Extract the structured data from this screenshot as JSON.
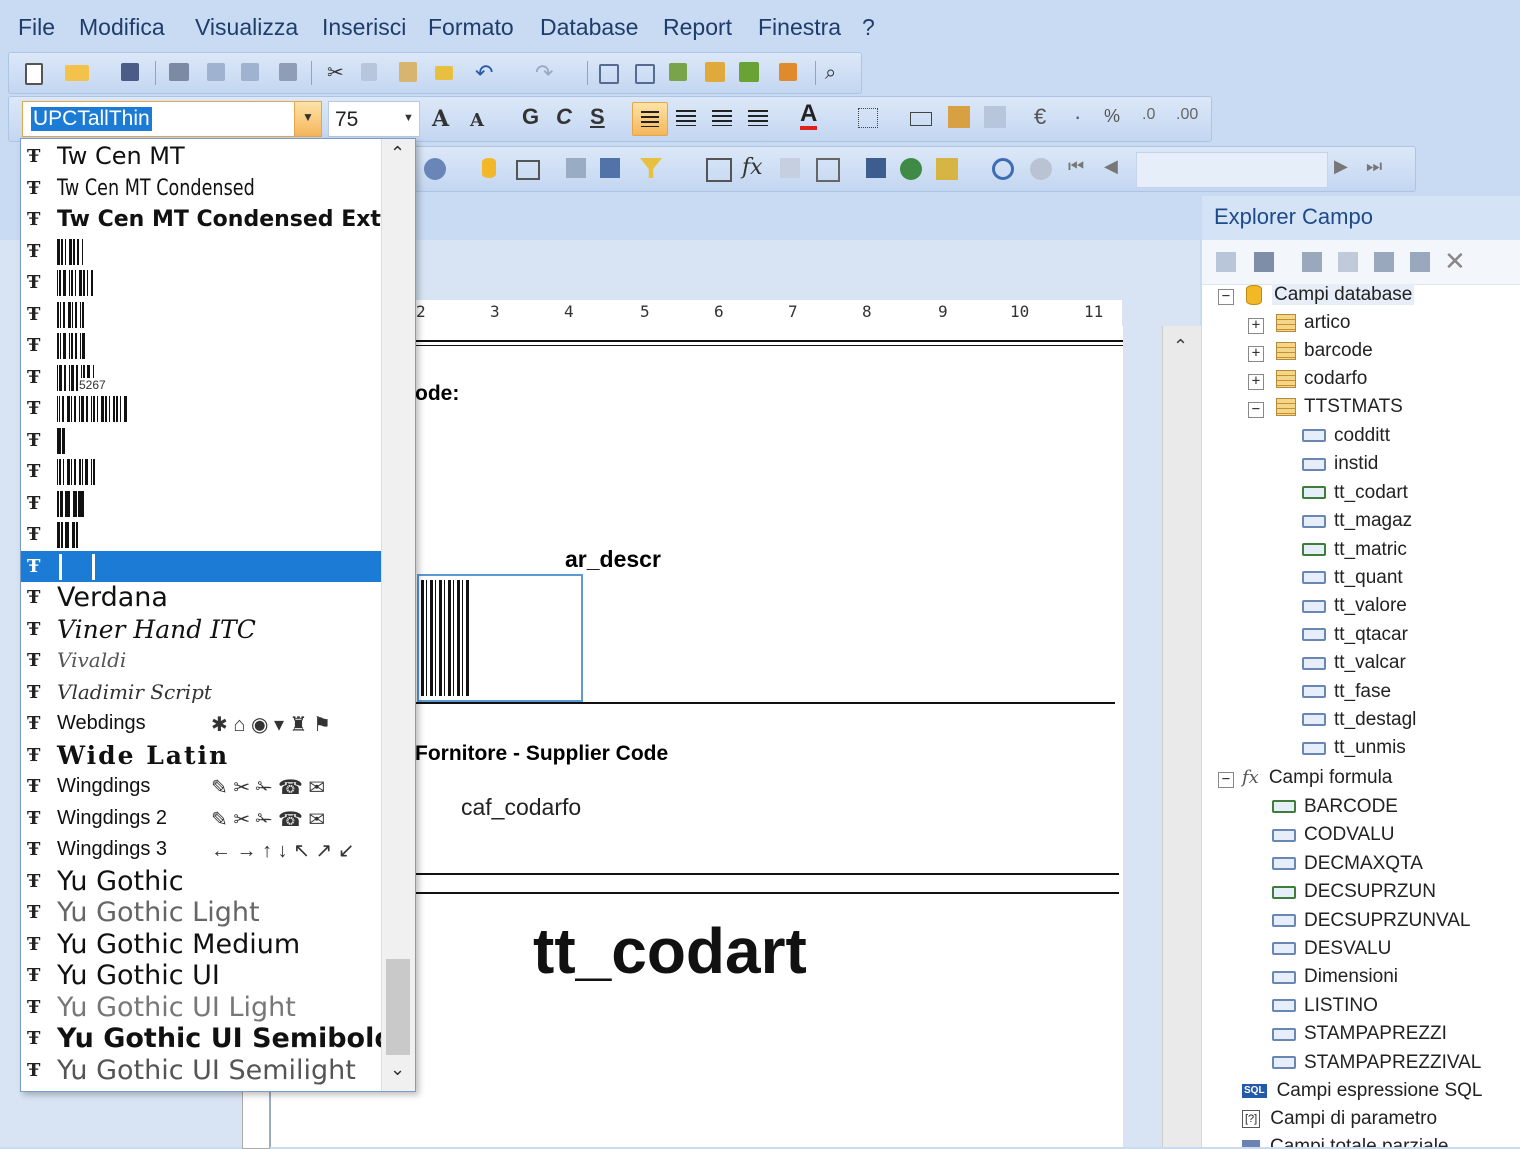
{
  "menu": {
    "file": "File",
    "modifica": "Modifica",
    "visualizza": "Visualizza",
    "inserisci": "Inserisci",
    "formato": "Formato",
    "database": "Database",
    "report": "Report",
    "finestra": "Finestra",
    "help": "?"
  },
  "format_toolbar": {
    "font_value": "UPCTallThin",
    "size_value": "75",
    "bold": "G",
    "italic": "C",
    "underline": "S",
    "currency": "€",
    "percent": "%"
  },
  "font_list": [
    {
      "name": "Tw Cen MT",
      "kind": "text"
    },
    {
      "name": "Tw Cen MT Condensed",
      "kind": "text"
    },
    {
      "name": "Tw Cen MT Condensed Extra",
      "kind": "text"
    },
    {
      "name": "",
      "kind": "barcode"
    },
    {
      "name": "",
      "kind": "barcode"
    },
    {
      "name": "",
      "kind": "barcode"
    },
    {
      "name": "",
      "kind": "barcode"
    },
    {
      "name": "5267",
      "kind": "barcode"
    },
    {
      "name": "",
      "kind": "barcode"
    },
    {
      "name": "",
      "kind": "barcode"
    },
    {
      "name": "",
      "kind": "barcode"
    },
    {
      "name": "",
      "kind": "barcode"
    },
    {
      "name": "",
      "kind": "barcode"
    },
    {
      "name": "",
      "kind": "selected"
    },
    {
      "name": "Verdana",
      "kind": "text"
    },
    {
      "name": "Viner Hand ITC",
      "kind": "text"
    },
    {
      "name": "Vivaldi",
      "kind": "text"
    },
    {
      "name": "Vladimir Script",
      "kind": "text"
    },
    {
      "name": "Webdings",
      "kind": "text"
    },
    {
      "name": "Wide Latin",
      "kind": "text"
    },
    {
      "name": "Wingdings",
      "kind": "text"
    },
    {
      "name": "Wingdings 2",
      "kind": "text"
    },
    {
      "name": "Wingdings 3",
      "kind": "text"
    },
    {
      "name": "Yu Gothic",
      "kind": "text"
    },
    {
      "name": "Yu Gothic Light",
      "kind": "text"
    },
    {
      "name": "Yu Gothic Medium",
      "kind": "text"
    },
    {
      "name": "Yu Gothic UI",
      "kind": "text"
    },
    {
      "name": "Yu Gothic UI Light",
      "kind": "text"
    },
    {
      "name": "Yu Gothic UI Semibold",
      "kind": "text"
    },
    {
      "name": "Yu Gothic UI Semilight",
      "kind": "text"
    }
  ],
  "ruler": {
    "ticks": [
      "2",
      "3",
      "4",
      "5",
      "6",
      "7",
      "8",
      "9",
      "10",
      "11"
    ]
  },
  "report": {
    "label_code": "ode:",
    "field_descr": "ar_descr",
    "label_supplier": "Fornitore - Supplier Code",
    "field_codarfo": "caf_codarfo",
    "field_codart": "tt_codart"
  },
  "explorer": {
    "title": "Explorer Campo",
    "db_group": "Campi database",
    "tables": [
      "artico",
      "barcode",
      "codarfo"
    ],
    "open_table": "TTSTMATS",
    "fields": [
      {
        "name": "codditt",
        "used": false
      },
      {
        "name": "instid",
        "used": false
      },
      {
        "name": "tt_codart",
        "used": true
      },
      {
        "name": "tt_magaz",
        "used": false
      },
      {
        "name": "tt_matric",
        "used": true
      },
      {
        "name": "tt_quant",
        "used": false
      },
      {
        "name": "tt_valore",
        "used": false
      },
      {
        "name": "tt_qtacar",
        "used": false
      },
      {
        "name": "tt_valcar",
        "used": false
      },
      {
        "name": "tt_fase",
        "used": false
      },
      {
        "name": "tt_destagl",
        "used": false
      },
      {
        "name": "tt_unmis",
        "used": false
      }
    ],
    "formula_group": "Campi formula",
    "formula_icon": "fx",
    "formulas": [
      {
        "name": "BARCODE",
        "used": true
      },
      {
        "name": "CODVALU",
        "used": false
      },
      {
        "name": "DECMAXQTA",
        "used": false
      },
      {
        "name": "DECSUPRZUN",
        "used": true
      },
      {
        "name": "DECSUPRZUNVAL",
        "used": false
      },
      {
        "name": "DESVALU",
        "used": false
      },
      {
        "name": "Dimensioni",
        "used": false
      },
      {
        "name": "LISTINO",
        "used": false
      },
      {
        "name": "STAMPAPREZZI",
        "used": false
      },
      {
        "name": "STAMPAPREZZIVAL",
        "used": false
      }
    ],
    "sql_group": "Campi espressione SQL",
    "sql_icon": "SQL",
    "param_group": "Campi di parametro",
    "param_icon": "[?]",
    "partial_group": "Campi totale parziale"
  },
  "colors": {
    "chrome": "#c9dbf3",
    "selection": "#1c7cd5",
    "accent_orange": "#f5b65b"
  }
}
